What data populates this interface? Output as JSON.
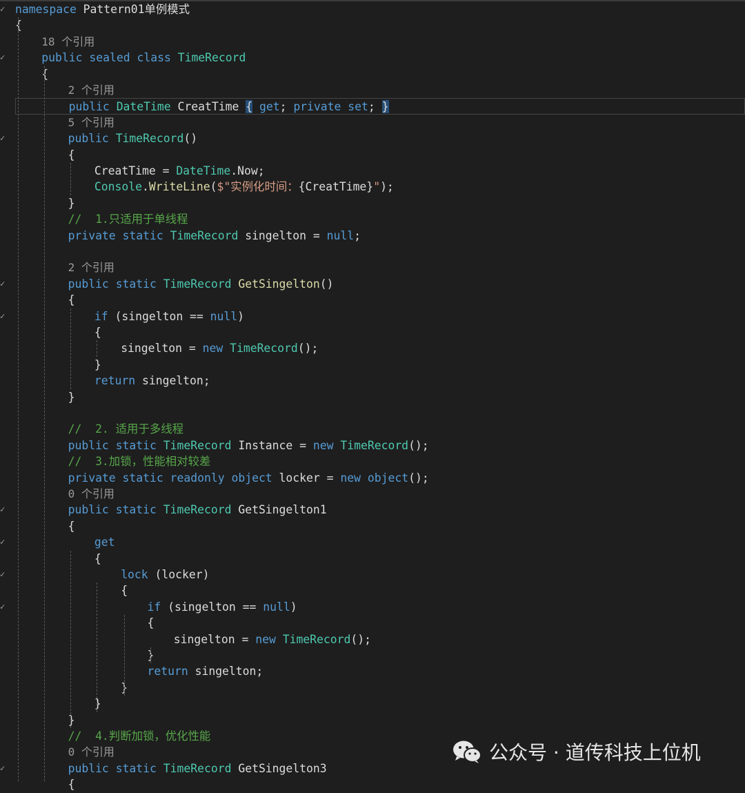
{
  "editor": {
    "lines": [
      {
        "kind": "code",
        "indent": 0,
        "mark": "✓",
        "tokens": [
          [
            "kw",
            "namespace"
          ],
          [
            "pl",
            " Pattern01单例模式"
          ]
        ]
      },
      {
        "kind": "code",
        "indent": 0,
        "tokens": [
          [
            "pl",
            "{"
          ]
        ]
      },
      {
        "kind": "ref",
        "indent": 1,
        "text": "18 个引用"
      },
      {
        "kind": "code",
        "indent": 1,
        "mark": "✓",
        "tokens": [
          [
            "kw",
            "public"
          ],
          [
            "pl",
            " "
          ],
          [
            "kw",
            "sealed"
          ],
          [
            "pl",
            " "
          ],
          [
            "kw",
            "class"
          ],
          [
            "pl",
            " "
          ],
          [
            "ty",
            "TimeRecord"
          ]
        ]
      },
      {
        "kind": "code",
        "indent": 1,
        "tokens": [
          [
            "pl",
            "{"
          ]
        ]
      },
      {
        "kind": "ref",
        "indent": 2,
        "text": "2 个引用"
      },
      {
        "kind": "code",
        "indent": 2,
        "current": true,
        "tokens": [
          [
            "kw",
            "public"
          ],
          [
            "pl",
            " "
          ],
          [
            "ty",
            "DateTime"
          ],
          [
            "pl",
            " CreatTime "
          ],
          [
            "hl",
            "{"
          ],
          [
            "pl",
            " "
          ],
          [
            "kw",
            "get"
          ],
          [
            "pl",
            "; "
          ],
          [
            "kw",
            "private"
          ],
          [
            "pl",
            " "
          ],
          [
            "kw",
            "set"
          ],
          [
            "pl",
            "; "
          ],
          [
            "hl",
            "}"
          ]
        ]
      },
      {
        "kind": "ref",
        "indent": 2,
        "text": "5 个引用"
      },
      {
        "kind": "code",
        "indent": 2,
        "mark": "✓",
        "tokens": [
          [
            "kw",
            "public"
          ],
          [
            "pl",
            " "
          ],
          [
            "ty",
            "TimeRecord"
          ],
          [
            "pl",
            "()"
          ]
        ]
      },
      {
        "kind": "code",
        "indent": 2,
        "tokens": [
          [
            "pl",
            "{"
          ]
        ]
      },
      {
        "kind": "code",
        "indent": 3,
        "tokens": [
          [
            "pl",
            "CreatTime = "
          ],
          [
            "ty",
            "DateTime"
          ],
          [
            "pl",
            ".Now;"
          ]
        ]
      },
      {
        "kind": "code",
        "indent": 3,
        "tokens": [
          [
            "ty",
            "Console"
          ],
          [
            "pl",
            "."
          ],
          [
            "fn",
            "WriteLine"
          ],
          [
            "pl",
            "("
          ],
          [
            "str",
            "$\"实例化时间："
          ],
          [
            "pl",
            "{CreatTime}"
          ],
          [
            "str",
            "\""
          ],
          [
            "pl",
            ");"
          ]
        ]
      },
      {
        "kind": "code",
        "indent": 2,
        "tokens": [
          [
            "pl",
            "}"
          ]
        ]
      },
      {
        "kind": "code",
        "indent": 2,
        "tokens": [
          [
            "cm",
            "//  1.只适用于单线程"
          ]
        ]
      },
      {
        "kind": "code",
        "indent": 2,
        "tokens": [
          [
            "kw",
            "private"
          ],
          [
            "pl",
            " "
          ],
          [
            "kw",
            "static"
          ],
          [
            "pl",
            " "
          ],
          [
            "ty",
            "TimeRecord"
          ],
          [
            "pl",
            " singelton = "
          ],
          [
            "kw",
            "null"
          ],
          [
            "pl",
            ";"
          ]
        ]
      },
      {
        "kind": "blank",
        "indent": 2
      },
      {
        "kind": "ref",
        "indent": 2,
        "text": "2 个引用"
      },
      {
        "kind": "code",
        "indent": 2,
        "mark": "✓",
        "tokens": [
          [
            "kw",
            "public"
          ],
          [
            "pl",
            " "
          ],
          [
            "kw",
            "static"
          ],
          [
            "pl",
            " "
          ],
          [
            "ty",
            "TimeRecord"
          ],
          [
            "pl",
            " "
          ],
          [
            "fn",
            "GetSingelton"
          ],
          [
            "pl",
            "()"
          ]
        ]
      },
      {
        "kind": "code",
        "indent": 2,
        "tokens": [
          [
            "pl",
            "{"
          ]
        ]
      },
      {
        "kind": "code",
        "indent": 3,
        "mark": "✓",
        "tokens": [
          [
            "kw",
            "if"
          ],
          [
            "pl",
            " (singelton == "
          ],
          [
            "kw",
            "null"
          ],
          [
            "pl",
            ")"
          ]
        ]
      },
      {
        "kind": "code",
        "indent": 3,
        "tokens": [
          [
            "pl",
            "{"
          ]
        ]
      },
      {
        "kind": "code",
        "indent": 4,
        "tokens": [
          [
            "pl",
            "singelton = "
          ],
          [
            "kw",
            "new"
          ],
          [
            "pl",
            " "
          ],
          [
            "ty",
            "TimeRecord"
          ],
          [
            "pl",
            "();"
          ]
        ]
      },
      {
        "kind": "code",
        "indent": 3,
        "tokens": [
          [
            "pl",
            "}"
          ]
        ]
      },
      {
        "kind": "code",
        "indent": 3,
        "tokens": [
          [
            "kw",
            "return"
          ],
          [
            "pl",
            " singelton;"
          ]
        ]
      },
      {
        "kind": "code",
        "indent": 2,
        "tokens": [
          [
            "pl",
            "}"
          ]
        ]
      },
      {
        "kind": "blank",
        "indent": 2
      },
      {
        "kind": "code",
        "indent": 2,
        "tokens": [
          [
            "cm",
            "//  2. 适用于多线程"
          ]
        ]
      },
      {
        "kind": "code",
        "indent": 2,
        "tokens": [
          [
            "kw",
            "public"
          ],
          [
            "pl",
            " "
          ],
          [
            "kw",
            "static"
          ],
          [
            "pl",
            " "
          ],
          [
            "ty",
            "TimeRecord"
          ],
          [
            "pl",
            " Instance = "
          ],
          [
            "kw",
            "new"
          ],
          [
            "pl",
            " "
          ],
          [
            "ty",
            "TimeRecord"
          ],
          [
            "pl",
            "();"
          ]
        ]
      },
      {
        "kind": "code",
        "indent": 2,
        "tokens": [
          [
            "cm",
            "//  3.加锁，性能相对较差"
          ]
        ]
      },
      {
        "kind": "code",
        "indent": 2,
        "tokens": [
          [
            "kw",
            "private"
          ],
          [
            "pl",
            " "
          ],
          [
            "kw",
            "static"
          ],
          [
            "pl",
            " "
          ],
          [
            "kw",
            "readonly"
          ],
          [
            "pl",
            " "
          ],
          [
            "kw",
            "object"
          ],
          [
            "pl",
            " locker = "
          ],
          [
            "kw",
            "new"
          ],
          [
            "pl",
            " "
          ],
          [
            "kw",
            "object"
          ],
          [
            "pl",
            "();"
          ]
        ]
      },
      {
        "kind": "ref",
        "indent": 2,
        "text": "0 个引用"
      },
      {
        "kind": "code",
        "indent": 2,
        "mark": "✓",
        "tokens": [
          [
            "kw",
            "public"
          ],
          [
            "pl",
            " "
          ],
          [
            "kw",
            "static"
          ],
          [
            "pl",
            " "
          ],
          [
            "ty",
            "TimeRecord"
          ],
          [
            "pl",
            " GetSingelton1"
          ]
        ]
      },
      {
        "kind": "code",
        "indent": 2,
        "tokens": [
          [
            "pl",
            "{"
          ]
        ]
      },
      {
        "kind": "code",
        "indent": 3,
        "mark": "✓",
        "tokens": [
          [
            "kw",
            "get"
          ]
        ]
      },
      {
        "kind": "code",
        "indent": 3,
        "tokens": [
          [
            "pl",
            "{"
          ]
        ]
      },
      {
        "kind": "code",
        "indent": 4,
        "mark": "✓",
        "tokens": [
          [
            "kw",
            "lock"
          ],
          [
            "pl",
            " (locker)"
          ]
        ]
      },
      {
        "kind": "code",
        "indent": 4,
        "tokens": [
          [
            "pl",
            "{"
          ]
        ]
      },
      {
        "kind": "code",
        "indent": 5,
        "mark": "✓",
        "tokens": [
          [
            "kw",
            "if"
          ],
          [
            "pl",
            " (singelton == "
          ],
          [
            "kw",
            "null"
          ],
          [
            "pl",
            ")"
          ]
        ]
      },
      {
        "kind": "code",
        "indent": 5,
        "tokens": [
          [
            "pl",
            "{"
          ]
        ]
      },
      {
        "kind": "code",
        "indent": 6,
        "tokens": [
          [
            "pl",
            "singelton = "
          ],
          [
            "kw",
            "new"
          ],
          [
            "pl",
            " "
          ],
          [
            "ty",
            "TimeRecord"
          ],
          [
            "pl",
            "();"
          ]
        ]
      },
      {
        "kind": "code",
        "indent": 5,
        "tokens": [
          [
            "pl",
            "}"
          ]
        ]
      },
      {
        "kind": "code",
        "indent": 5,
        "tokens": [
          [
            "kw",
            "return"
          ],
          [
            "pl",
            " singelton;"
          ]
        ]
      },
      {
        "kind": "code",
        "indent": 4,
        "tokens": [
          [
            "pl",
            "}"
          ]
        ]
      },
      {
        "kind": "code",
        "indent": 3,
        "tokens": [
          [
            "pl",
            "}"
          ]
        ]
      },
      {
        "kind": "code",
        "indent": 2,
        "tokens": [
          [
            "pl",
            "}"
          ]
        ]
      },
      {
        "kind": "code",
        "indent": 2,
        "tokens": [
          [
            "cm",
            "//  4.判断加锁，优化性能"
          ]
        ]
      },
      {
        "kind": "ref",
        "indent": 2,
        "text": "0 个引用"
      },
      {
        "kind": "code",
        "indent": 2,
        "mark": "✓",
        "tokens": [
          [
            "kw",
            "public"
          ],
          [
            "pl",
            " "
          ],
          [
            "kw",
            "static"
          ],
          [
            "pl",
            " "
          ],
          [
            "ty",
            "TimeRecord"
          ],
          [
            "pl",
            " GetSingelton3"
          ]
        ]
      },
      {
        "kind": "code",
        "indent": 2,
        "tokens": [
          [
            "pl",
            "{"
          ]
        ]
      }
    ]
  },
  "watermark": {
    "icon": "wechat-icon",
    "text": "公众号 · 道传科技上位机"
  },
  "colors": {
    "background": "#1e1e1e",
    "keyword": "#569cd6",
    "type": "#4ec9b0",
    "method": "#dcdcaa",
    "string": "#d69d85",
    "comment": "#57a64a",
    "plain": "#dcdcdc"
  }
}
